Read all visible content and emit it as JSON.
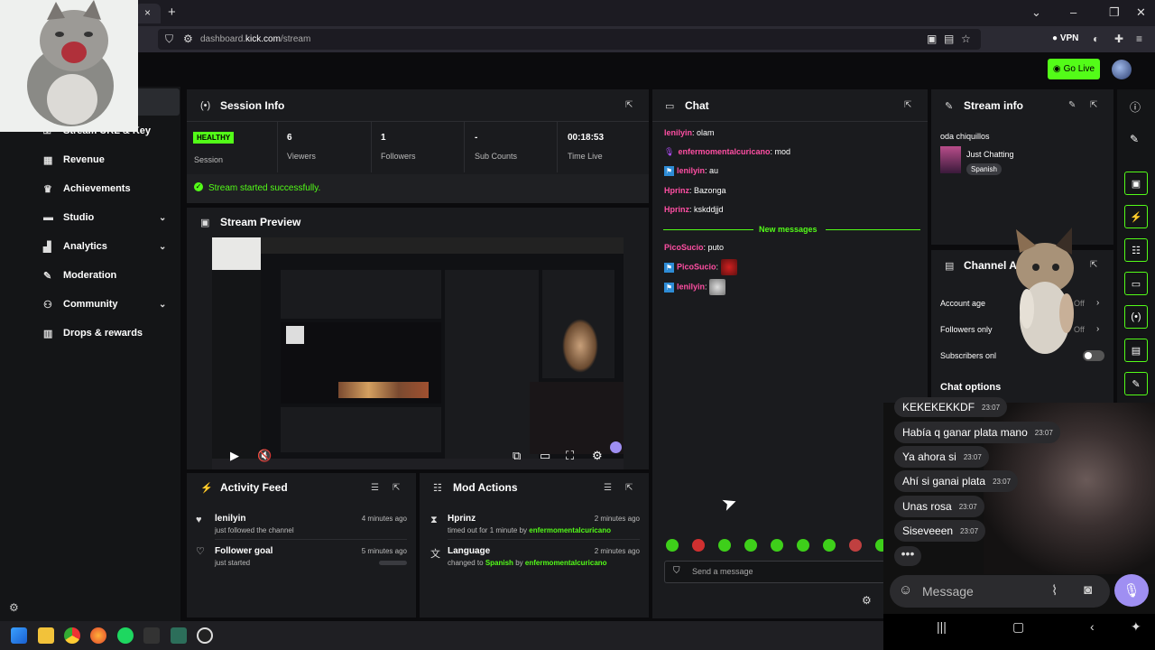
{
  "browser": {
    "url_prefix": "dashboard.",
    "url_domain": "kick.com",
    "url_path": "/stream",
    "vpn_label": "VPN",
    "tab_close": "×",
    "tab_new": "+"
  },
  "header": {
    "go_live_label": "Go Live",
    "accent_color": "#53fc18"
  },
  "sidebar": {
    "items": [
      {
        "label": "Stream URL & Key",
        "icon": "key-icon",
        "expandable": false
      },
      {
        "label": "Revenue",
        "icon": "revenue-icon",
        "expandable": false
      },
      {
        "label": "Achievements",
        "icon": "trophy-icon",
        "expandable": false
      },
      {
        "label": "Studio",
        "icon": "studio-icon",
        "expandable": true
      },
      {
        "label": "Analytics",
        "icon": "analytics-icon",
        "expandable": true
      },
      {
        "label": "Moderation",
        "icon": "wrench-icon",
        "expandable": false
      },
      {
        "label": "Community",
        "icon": "community-icon",
        "expandable": true
      },
      {
        "label": "Drops & rewards",
        "icon": "drops-icon",
        "expandable": false
      }
    ]
  },
  "session_info": {
    "title": "Session Info",
    "health_badge": "HEALTHY",
    "health_label": "Session",
    "stats": [
      {
        "value": "6",
        "label": "Viewers"
      },
      {
        "value": "1",
        "label": "Followers"
      },
      {
        "value": "-",
        "label": "Sub Counts"
      },
      {
        "value": "00:18:53",
        "label": "Time Live"
      }
    ],
    "status_message": "Stream started successfully."
  },
  "stream_preview": {
    "title": "Stream Preview"
  },
  "activity_feed": {
    "title": "Activity Feed",
    "items": [
      {
        "name": "lenilyin",
        "detail": "just followed the channel",
        "time": "4 minutes ago"
      },
      {
        "name": "Follower goal",
        "detail": "just started",
        "time": "5 minutes ago"
      }
    ]
  },
  "mod_actions": {
    "title": "Mod Actions",
    "items": [
      {
        "name": "Hprinz",
        "detail_pre": "timed out for 1 minute by",
        "detail_user": "enfermomentalcuricano",
        "time": "2 minutes ago"
      },
      {
        "name": "Language",
        "detail_pre": "changed to",
        "detail_value": "Spanish",
        "detail_mid": "by",
        "detail_user": "enfermomentalcuricano",
        "time": "2 minutes ago"
      }
    ]
  },
  "chat": {
    "title": "Chat",
    "messages": [
      {
        "user": "lenilyin",
        "text": ": olam",
        "color": "#ff4fa3"
      },
      {
        "user": "enfermomentalcuricano",
        "text": ": mod",
        "color": "#ff4fa3"
      },
      {
        "user": "lenilyin",
        "text": ": au",
        "color": "#ff4fa3"
      },
      {
        "user": "Hprinz",
        "text": ": Bazonga",
        "color": "#ff4fa3"
      },
      {
        "user": "Hprinz",
        "text": ": kskddjjd",
        "color": "#ff4fa3"
      },
      {
        "user": "PicoSucio",
        "text": ": puto",
        "color": "#ff4fa3"
      },
      {
        "user": "PicoSucio",
        "text": ":",
        "color": "#ff4fa3"
      },
      {
        "user": "lenilyin",
        "text": ":",
        "color": "#ff4fa3"
      }
    ],
    "new_messages_label": "New messages",
    "input_placeholder": "Send a message"
  },
  "stream_info": {
    "title": "Stream info",
    "stream_title": "oda chiquillos",
    "category": "Just Chatting",
    "language": "Spanish"
  },
  "channel_actions": {
    "title": "Channel A",
    "rows": [
      {
        "label": "Account age",
        "value": "Off"
      },
      {
        "label": "Followers only",
        "value": "Off"
      },
      {
        "label": "Subscribers onl",
        "value": ""
      }
    ],
    "chat_options_label": "Chat options"
  },
  "phone_chat": {
    "messages": [
      {
        "text": "KEKEKEKKDF",
        "time": "23:07"
      },
      {
        "text": "Había q ganar plata mano",
        "time": "23:07"
      },
      {
        "text": "Ya ahora si",
        "time": "23:07"
      },
      {
        "text": "Ahí si ganai plata",
        "time": "23:07"
      },
      {
        "text": "Unas rosa",
        "time": "23:07"
      },
      {
        "text": "Siseveeen",
        "time": "23:07"
      }
    ],
    "typing": "•••",
    "input_placeholder": "Message"
  }
}
